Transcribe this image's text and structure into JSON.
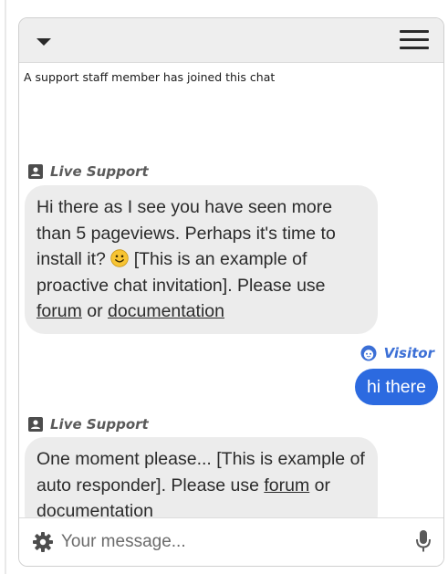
{
  "header": {
    "collapse_icon": "caret-down-icon",
    "menu_icon": "hamburger-menu-icon"
  },
  "messages": {
    "system_notice": "A support staff member has joined this chat",
    "items": [
      {
        "sender": "Live Support",
        "sender_icon": "operator-icon",
        "text_1": "Hi there as I see you have seen more than 5 pageviews. Perhaps it's time to install it?",
        "emoji": "smiley-emoji",
        "text_2": "[This is an example of proactive chat invitation]. Please use",
        "link_1": "forum",
        "between": "or",
        "link_2": "documentation"
      },
      {
        "sender": "Visitor",
        "sender_icon": "visitor-avatar-icon",
        "text": "hi there"
      },
      {
        "sender": "Live Support",
        "sender_icon": "operator-icon",
        "text_1": "One moment please... [This is example of auto responder]. Please use",
        "link_1": "forum",
        "between": "or",
        "link_2": "documentation"
      }
    ]
  },
  "footer": {
    "settings_icon": "gear-icon",
    "placeholder": "Your message...",
    "mic_icon": "microphone-icon"
  },
  "colors": {
    "visitor_bubble": "#2c6ae0",
    "visitor_name": "#3b6fd6",
    "operator_bubble": "#ececec",
    "header_bg": "#eeeeee"
  }
}
